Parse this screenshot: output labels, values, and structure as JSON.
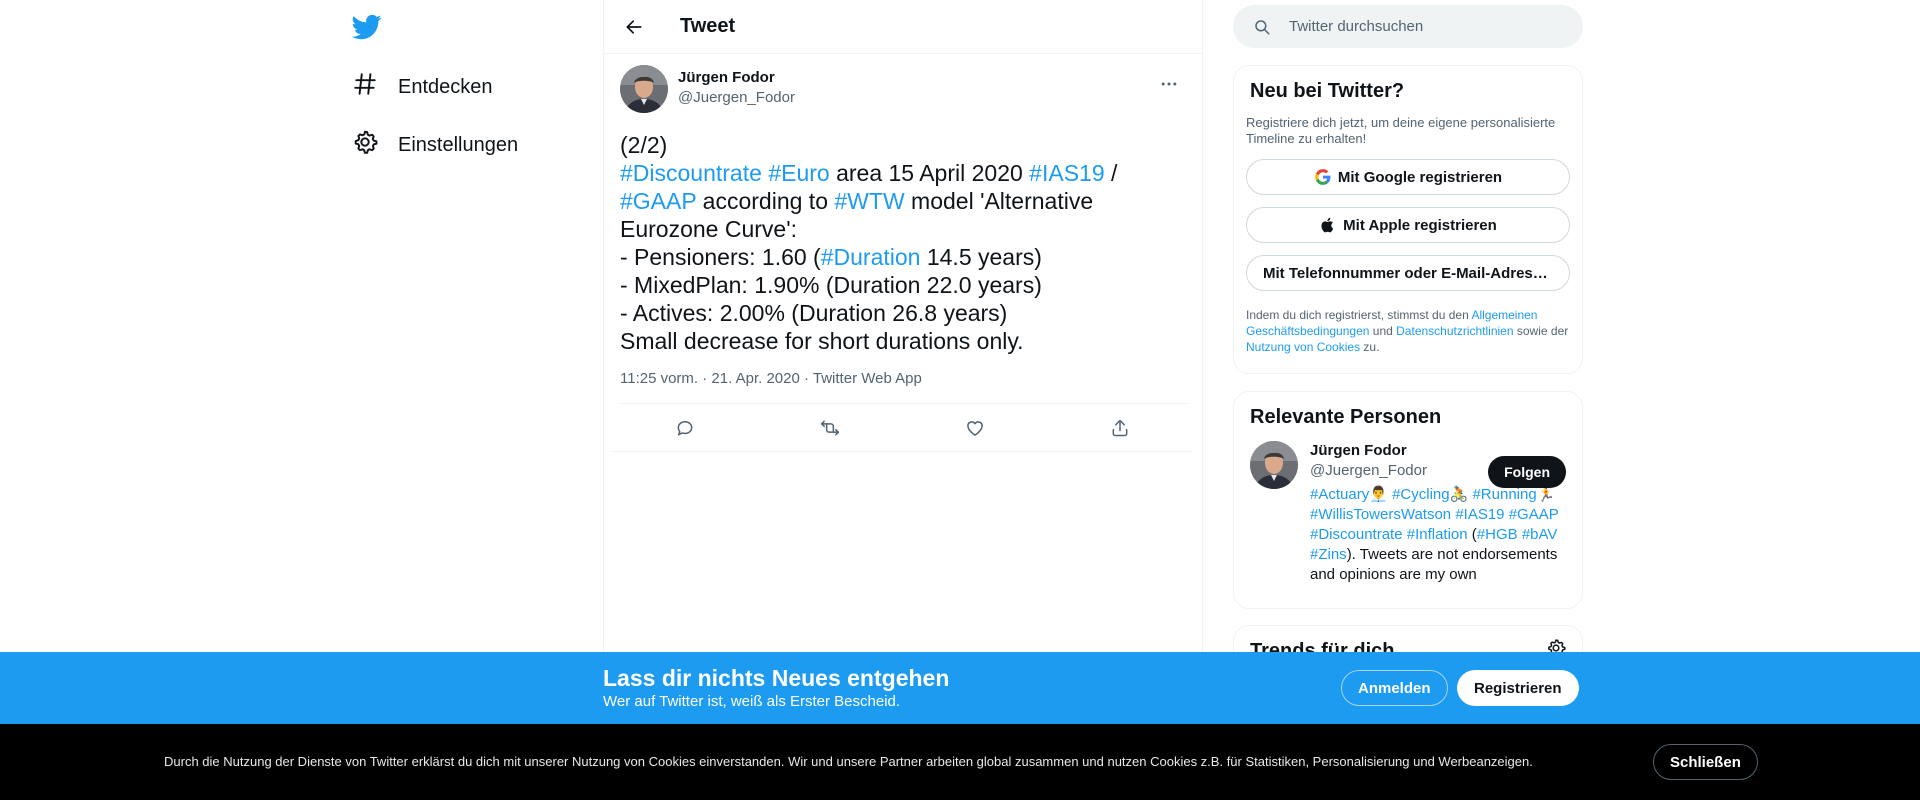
{
  "colors": {
    "accent": "#1d9bf0",
    "text": "#0f1419",
    "muted": "#536471",
    "border": "#eff3f4"
  },
  "nav": {
    "logo_icon": "twitter-bird-icon",
    "items": [
      {
        "label": "Entdecken",
        "icon": "hash-icon"
      },
      {
        "label": "Einstellungen",
        "icon": "gear-icon"
      }
    ]
  },
  "header": {
    "title": "Tweet"
  },
  "tweet": {
    "author_name": "Jürgen Fodor",
    "author_handle": "@Juergen_Fodor",
    "line1": "(2/2)",
    "tags": {
      "discountrate": "#Discountrate",
      "euro": "#Euro",
      "ias19": "#IAS19",
      "gaap": "#GAAP",
      "wtw": "#WTW",
      "duration": "#Duration"
    },
    "t_area": " area 15 April 2020 ",
    "t_slash": " /",
    "t_according": " according to ",
    "t_model": " model 'Alternative Eurozone Curve':",
    "t_pensioners": "- Pensioners: 1.60 (",
    "t_pensioners_end": " 14.5 years)",
    "t_mixed": "- MixedPlan: 1.90% (Duration 22.0 years)",
    "t_actives": "- Actives: 2.00% (Duration 26.8 years)",
    "t_small": "Small decrease for short durations only.",
    "meta": "11:25 vorm. · 21. Apr. 2020 · Twitter Web App"
  },
  "search": {
    "placeholder": "Twitter durchsuchen"
  },
  "new_card": {
    "title": "Neu bei Twitter?",
    "subtitle": "Registriere dich jetzt, um deine eigene personalisierte Timeline zu erhalten!",
    "google": "Mit Google registrieren",
    "apple": "Mit Apple registrieren",
    "phone": "Mit Telefonnummer oder E-Mail-Adresse registrieren",
    "legal_1": "Indem du dich registrierst, stimmst du den ",
    "legal_link1": "Allgemeinen Geschäftsbedingungen",
    "legal_2": " und ",
    "legal_link2": "Datenschutzrichtlinien",
    "legal_3": " sowie der ",
    "legal_link3": "Nutzung von Cookies",
    "legal_4": " zu."
  },
  "people": {
    "title": "Relevante Personen",
    "name": "Jürgen Fodor",
    "handle": "@Juergen_Fodor",
    "follow": "Folgen",
    "bio_tags": {
      "actuary": "#Actuary",
      "cycling": "#Cycling",
      "running": "#Running",
      "wtw": "#WillisTowersWatson",
      "ias19": "#IAS19",
      "gaap": "#GAAP",
      "discountrate": "#Discountrate",
      "inflation": "#Inflation",
      "hgb": "#HGB",
      "bav": "#bAV",
      "zins": "#Zins"
    },
    "bio_emoji1": "👨‍💼",
    "bio_emoji2": "🚴",
    "bio_emoji3": "🏃",
    "bio_open": " (",
    "bio_tail": "). Tweets are not endorsements and opinions are my own"
  },
  "trends": {
    "title": "Trends für dich"
  },
  "signup_bar": {
    "title": "Lass dir nichts Neues entgehen",
    "subtitle": "Wer auf Twitter ist, weiß als Erster Bescheid.",
    "login": "Anmelden",
    "register": "Registrieren"
  },
  "cookie_bar": {
    "text": "Durch die Nutzung der Dienste von Twitter erklärst du dich mit unserer Nutzung von Cookies einverstanden. Wir und unsere Partner arbeiten global zusammen und nutzen Cookies z.B. für Statistiken, Personalisierung und Werbeanzeigen.",
    "close": "Schließen"
  }
}
